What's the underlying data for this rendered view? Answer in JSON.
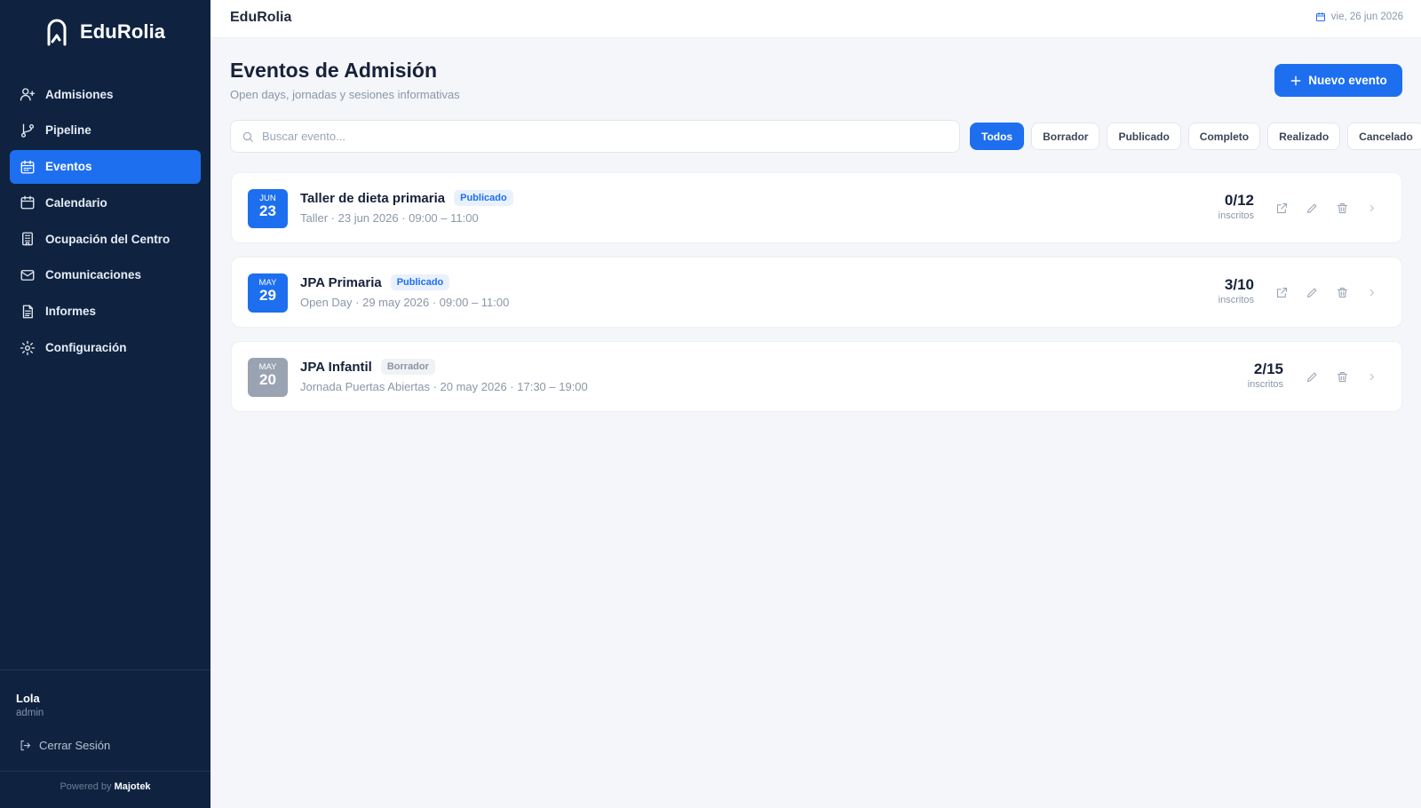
{
  "brand": {
    "name": "EduRolia"
  },
  "sidebar": {
    "items": [
      {
        "label": "Admisiones",
        "icon": "user-plus-icon"
      },
      {
        "label": "Pipeline",
        "icon": "git-branch-icon"
      },
      {
        "label": "Eventos",
        "icon": "calendar-icon",
        "active": true
      },
      {
        "label": "Calendario",
        "icon": "calendar-icon"
      },
      {
        "label": "Ocupación del Centro",
        "icon": "building-icon"
      },
      {
        "label": "Comunicaciones",
        "icon": "mail-icon"
      },
      {
        "label": "Informes",
        "icon": "file-text-icon"
      },
      {
        "label": "Configuración",
        "icon": "gear-icon"
      }
    ],
    "user": {
      "name": "Lola",
      "role": "admin"
    },
    "logout_label": "Cerrar Sesión",
    "powered_prefix": "Powered by",
    "powered_brand": "Majotek"
  },
  "topbar": {
    "title": "EduRolia",
    "date": "vie, 26 jun 2026"
  },
  "header": {
    "title": "Eventos de Admisión",
    "subtitle": "Open days, jornadas y sesiones informativas",
    "new_button": "Nuevo evento"
  },
  "search": {
    "placeholder": "Buscar evento..."
  },
  "filters": [
    {
      "label": "Todos",
      "active": true
    },
    {
      "label": "Borrador"
    },
    {
      "label": "Publicado"
    },
    {
      "label": "Completo"
    },
    {
      "label": "Realizado"
    },
    {
      "label": "Cancelado"
    }
  ],
  "events": [
    {
      "month": "JUN",
      "day": "23",
      "title": "Taller de dieta primaria",
      "status": "Publicado",
      "meta": "Taller · 23 jun 2026 · 09:00 – 11:00",
      "count": "0/12",
      "count_label": "inscritos"
    },
    {
      "month": "MAY",
      "day": "29",
      "title": "JPA Primaria",
      "status": "Publicado",
      "meta": "Open Day · 29 may 2026 · 09:00 – 11:00",
      "count": "3/10",
      "count_label": "inscritos"
    },
    {
      "month": "MAY",
      "day": "20",
      "title": "JPA Infantil",
      "status": "Borrador",
      "meta": "Jornada Puertas Abiertas · 20 may 2026 · 17:30 – 19:00",
      "count": "2/15",
      "count_label": "inscritos"
    }
  ],
  "colors": {
    "sidebar_bg": "#0f2340",
    "accent": "#1d6ff0",
    "page_bg": "#f4f6f9",
    "draft_badge": "#9aa3b2"
  }
}
